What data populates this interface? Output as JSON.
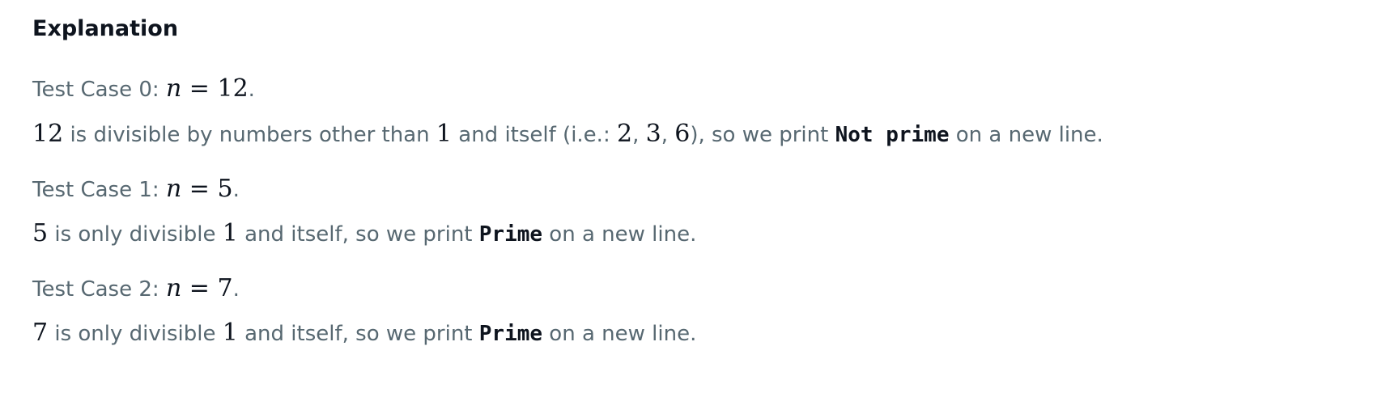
{
  "heading": "Explanation",
  "cases": [
    {
      "label": "Test Case 0: ",
      "var": "n",
      "eq": " = ",
      "value": "12",
      "period": ".",
      "detail": {
        "num": "12",
        "t1": " is divisible by numbers other than ",
        "one": "1",
        "t2": " and itself (i.e.: ",
        "d1": "2",
        "c1": ", ",
        "d2": "3",
        "c2": ", ",
        "d3": "6",
        "t3": "), so we print ",
        "code": "Not prime",
        "t4": " on a new line."
      }
    },
    {
      "label": "Test Case 1: ",
      "var": "n",
      "eq": " = ",
      "value": "5",
      "period": ".",
      "detail": {
        "num": "5",
        "t1": " is only divisible ",
        "one": "1",
        "t2": " and itself, so we print ",
        "code": "Prime",
        "t3": " on a new line."
      }
    },
    {
      "label": "Test Case 2: ",
      "var": "n",
      "eq": " = ",
      "value": "7",
      "period": ".",
      "detail": {
        "num": "7",
        "t1": " is only divisible ",
        "one": "1",
        "t2": " and itself, so we print ",
        "code": "Prime",
        "t3": " on a new line."
      }
    }
  ]
}
